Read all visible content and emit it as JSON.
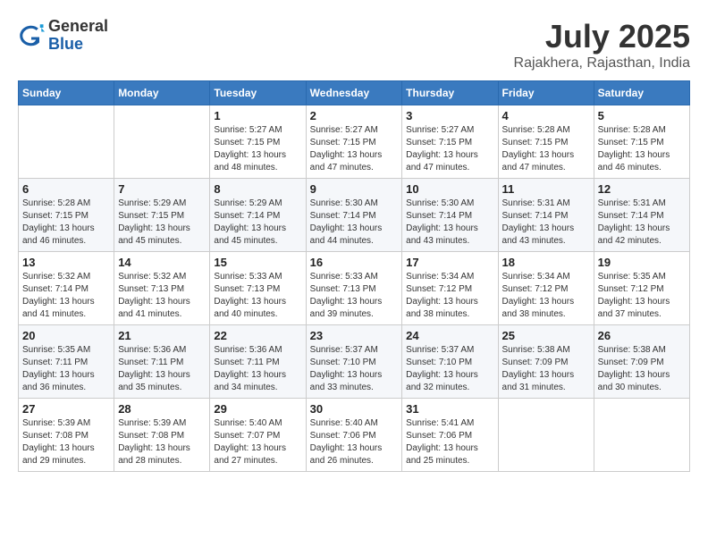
{
  "header": {
    "logo": {
      "general": "General",
      "blue": "Blue"
    },
    "title": "July 2025",
    "location": "Rajakhera, Rajasthan, India"
  },
  "calendar": {
    "weekdays": [
      "Sunday",
      "Monday",
      "Tuesday",
      "Wednesday",
      "Thursday",
      "Friday",
      "Saturday"
    ],
    "weeks": [
      [
        {
          "day": "",
          "info": ""
        },
        {
          "day": "",
          "info": ""
        },
        {
          "day": "1",
          "info": "Sunrise: 5:27 AM\nSunset: 7:15 PM\nDaylight: 13 hours and 48 minutes."
        },
        {
          "day": "2",
          "info": "Sunrise: 5:27 AM\nSunset: 7:15 PM\nDaylight: 13 hours and 47 minutes."
        },
        {
          "day": "3",
          "info": "Sunrise: 5:27 AM\nSunset: 7:15 PM\nDaylight: 13 hours and 47 minutes."
        },
        {
          "day": "4",
          "info": "Sunrise: 5:28 AM\nSunset: 7:15 PM\nDaylight: 13 hours and 47 minutes."
        },
        {
          "day": "5",
          "info": "Sunrise: 5:28 AM\nSunset: 7:15 PM\nDaylight: 13 hours and 46 minutes."
        }
      ],
      [
        {
          "day": "6",
          "info": "Sunrise: 5:28 AM\nSunset: 7:15 PM\nDaylight: 13 hours and 46 minutes."
        },
        {
          "day": "7",
          "info": "Sunrise: 5:29 AM\nSunset: 7:15 PM\nDaylight: 13 hours and 45 minutes."
        },
        {
          "day": "8",
          "info": "Sunrise: 5:29 AM\nSunset: 7:14 PM\nDaylight: 13 hours and 45 minutes."
        },
        {
          "day": "9",
          "info": "Sunrise: 5:30 AM\nSunset: 7:14 PM\nDaylight: 13 hours and 44 minutes."
        },
        {
          "day": "10",
          "info": "Sunrise: 5:30 AM\nSunset: 7:14 PM\nDaylight: 13 hours and 43 minutes."
        },
        {
          "day": "11",
          "info": "Sunrise: 5:31 AM\nSunset: 7:14 PM\nDaylight: 13 hours and 43 minutes."
        },
        {
          "day": "12",
          "info": "Sunrise: 5:31 AM\nSunset: 7:14 PM\nDaylight: 13 hours and 42 minutes."
        }
      ],
      [
        {
          "day": "13",
          "info": "Sunrise: 5:32 AM\nSunset: 7:14 PM\nDaylight: 13 hours and 41 minutes."
        },
        {
          "day": "14",
          "info": "Sunrise: 5:32 AM\nSunset: 7:13 PM\nDaylight: 13 hours and 41 minutes."
        },
        {
          "day": "15",
          "info": "Sunrise: 5:33 AM\nSunset: 7:13 PM\nDaylight: 13 hours and 40 minutes."
        },
        {
          "day": "16",
          "info": "Sunrise: 5:33 AM\nSunset: 7:13 PM\nDaylight: 13 hours and 39 minutes."
        },
        {
          "day": "17",
          "info": "Sunrise: 5:34 AM\nSunset: 7:12 PM\nDaylight: 13 hours and 38 minutes."
        },
        {
          "day": "18",
          "info": "Sunrise: 5:34 AM\nSunset: 7:12 PM\nDaylight: 13 hours and 38 minutes."
        },
        {
          "day": "19",
          "info": "Sunrise: 5:35 AM\nSunset: 7:12 PM\nDaylight: 13 hours and 37 minutes."
        }
      ],
      [
        {
          "day": "20",
          "info": "Sunrise: 5:35 AM\nSunset: 7:11 PM\nDaylight: 13 hours and 36 minutes."
        },
        {
          "day": "21",
          "info": "Sunrise: 5:36 AM\nSunset: 7:11 PM\nDaylight: 13 hours and 35 minutes."
        },
        {
          "day": "22",
          "info": "Sunrise: 5:36 AM\nSunset: 7:11 PM\nDaylight: 13 hours and 34 minutes."
        },
        {
          "day": "23",
          "info": "Sunrise: 5:37 AM\nSunset: 7:10 PM\nDaylight: 13 hours and 33 minutes."
        },
        {
          "day": "24",
          "info": "Sunrise: 5:37 AM\nSunset: 7:10 PM\nDaylight: 13 hours and 32 minutes."
        },
        {
          "day": "25",
          "info": "Sunrise: 5:38 AM\nSunset: 7:09 PM\nDaylight: 13 hours and 31 minutes."
        },
        {
          "day": "26",
          "info": "Sunrise: 5:38 AM\nSunset: 7:09 PM\nDaylight: 13 hours and 30 minutes."
        }
      ],
      [
        {
          "day": "27",
          "info": "Sunrise: 5:39 AM\nSunset: 7:08 PM\nDaylight: 13 hours and 29 minutes."
        },
        {
          "day": "28",
          "info": "Sunrise: 5:39 AM\nSunset: 7:08 PM\nDaylight: 13 hours and 28 minutes."
        },
        {
          "day": "29",
          "info": "Sunrise: 5:40 AM\nSunset: 7:07 PM\nDaylight: 13 hours and 27 minutes."
        },
        {
          "day": "30",
          "info": "Sunrise: 5:40 AM\nSunset: 7:06 PM\nDaylight: 13 hours and 26 minutes."
        },
        {
          "day": "31",
          "info": "Sunrise: 5:41 AM\nSunset: 7:06 PM\nDaylight: 13 hours and 25 minutes."
        },
        {
          "day": "",
          "info": ""
        },
        {
          "day": "",
          "info": ""
        }
      ]
    ]
  }
}
